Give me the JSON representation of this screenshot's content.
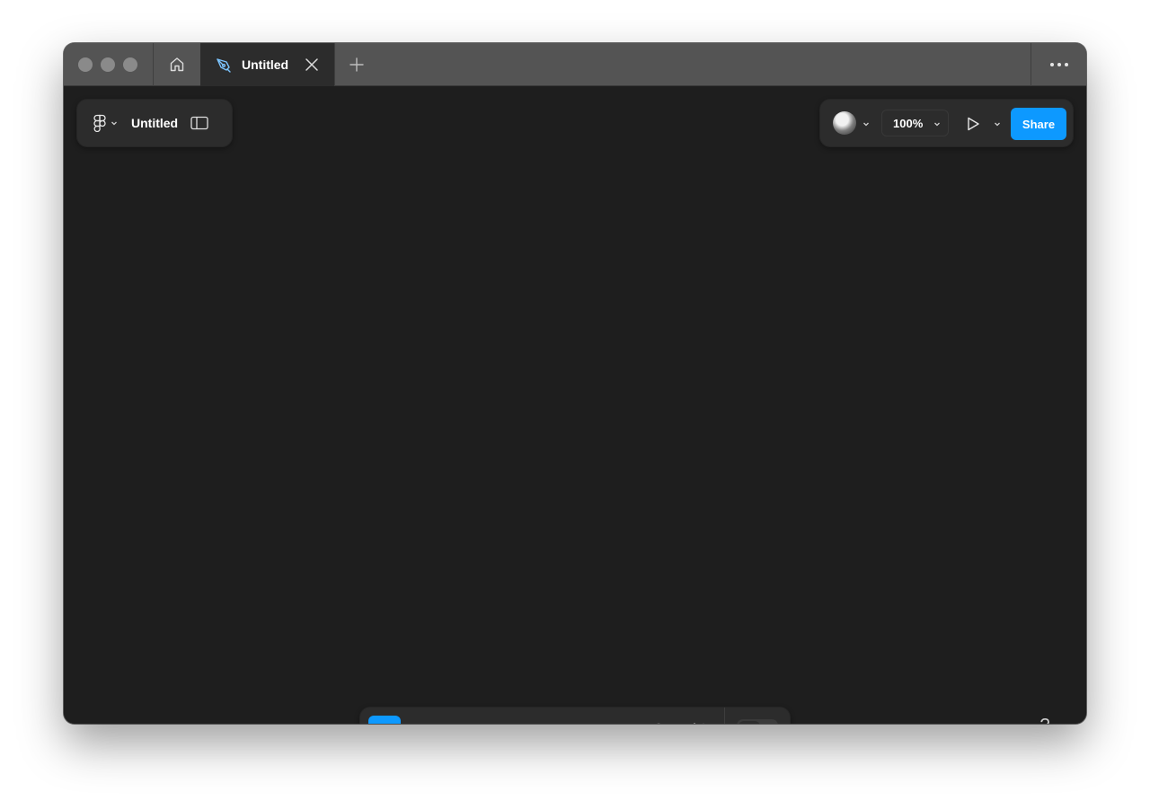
{
  "titlebar": {
    "tab_title": "Untitled",
    "icons": [
      "home-icon",
      "pen-tool-icon",
      "close-icon",
      "plus-icon",
      "more-icon"
    ]
  },
  "file_panel": {
    "file_name": "Untitled",
    "icons": [
      "figma-logo-icon",
      "chevron-down-icon",
      "sidebar-toggle-icon"
    ]
  },
  "top_right": {
    "zoom_label": "100%",
    "share_label": "Share",
    "icons": [
      "avatar",
      "chevron-down-icon",
      "play-icon"
    ]
  },
  "toolbar": {
    "tools": [
      "move-tool",
      "frame-tool",
      "shape-tool",
      "pen-tool",
      "text-tool",
      "comment-tool",
      "actions-tool"
    ],
    "active_tool": "move-tool",
    "dev_mode_icon": "code-icon"
  },
  "help": {
    "label": "?"
  },
  "colors": {
    "accent": "#0d99ff",
    "canvas": "#1e1e1e",
    "panel": "#2c2c2c",
    "titlebar": "#545454"
  }
}
